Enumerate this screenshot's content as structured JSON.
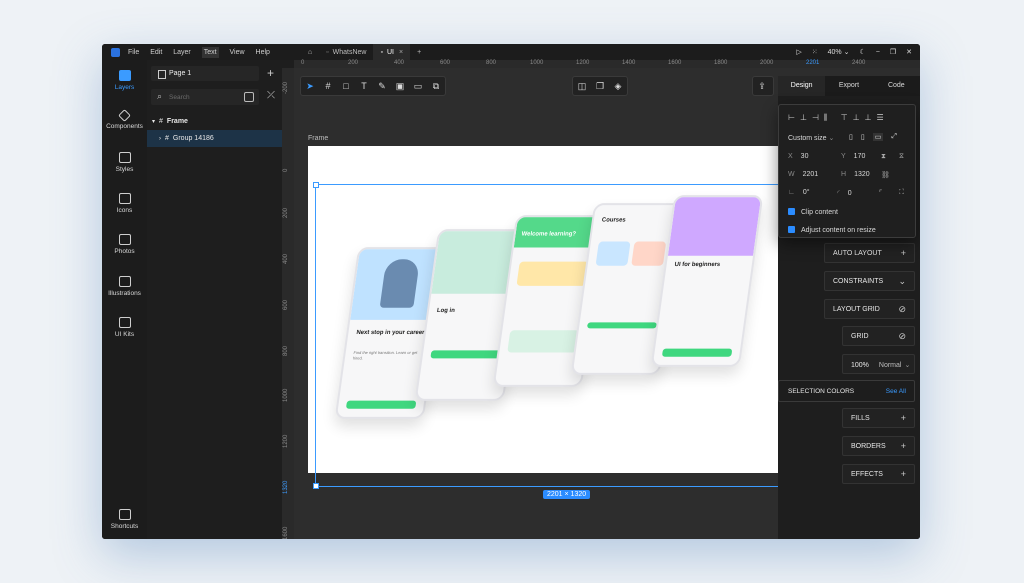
{
  "menu": [
    "File",
    "Edit",
    "Layer",
    "Text",
    "View",
    "Help"
  ],
  "tabs": [
    {
      "label": "WhatsNew"
    },
    {
      "label": "UI"
    }
  ],
  "zoom": "40%",
  "ruler_top": [
    "0",
    "200",
    "400",
    "600",
    "800",
    "1000",
    "1200",
    "1400",
    "1600",
    "1800",
    "2000",
    "2201",
    "2400"
  ],
  "ruler_left": [
    "-200",
    "0",
    "200",
    "400",
    "600",
    "800",
    "1000",
    "1200",
    "1320",
    "1600"
  ],
  "rail": [
    {
      "label": "Layers",
      "icon": "layers-icon"
    },
    {
      "label": "Components",
      "icon": "components-icon"
    },
    {
      "label": "Styles",
      "icon": "styles-icon"
    },
    {
      "label": "Icons",
      "icon": "icons-icon"
    },
    {
      "label": "Photos",
      "icon": "photos-icon"
    },
    {
      "label": "Illustrations",
      "icon": "illustrations-icon"
    },
    {
      "label": "UI Kits",
      "icon": "ui-kits-icon"
    }
  ],
  "shortcuts_label": "Shortcuts",
  "page_select": "Page 1",
  "search_placeholder": "Search",
  "layers": [
    {
      "name": "Frame"
    },
    {
      "name": "Group 14186"
    }
  ],
  "canvas": {
    "frame_label": "Frame",
    "dimensions": "2201 × 1320"
  },
  "phones": [
    {
      "title": "Next stop in your career",
      "sub": "Find the right transition. Learn or get hired."
    },
    {
      "title": "Log in"
    },
    {
      "title": "Welcome learning?"
    },
    {
      "title": "Courses"
    },
    {
      "title": "UI for beginners"
    }
  ],
  "right_tabs": [
    "Design",
    "Export",
    "Code"
  ],
  "popover": {
    "size_preset": "Custom size",
    "x": "30",
    "y": "170",
    "w": "2201",
    "h": "1320",
    "rotation": "0°",
    "radius": "0",
    "clip_content": "Clip content",
    "adjust_content": "Adjust content on resize"
  },
  "sections": {
    "auto_layout": "AUTO LAYOUT",
    "constraints": "CONSTRAINTS",
    "layout_grid": "LAYOUT GRID",
    "grid": "GRID",
    "opacity": "100%",
    "blend": "Normal",
    "selection_colors": "SELECTION COLORS",
    "see_all": "See All",
    "fills": "FILLS",
    "borders": "BORDERS",
    "effects": "EFFECTS"
  },
  "colors": {
    "accent": "#3b9bff",
    "window": "#1e1e1e",
    "canvas": "#2d2d2d",
    "brand_green": "#3fd77f"
  }
}
